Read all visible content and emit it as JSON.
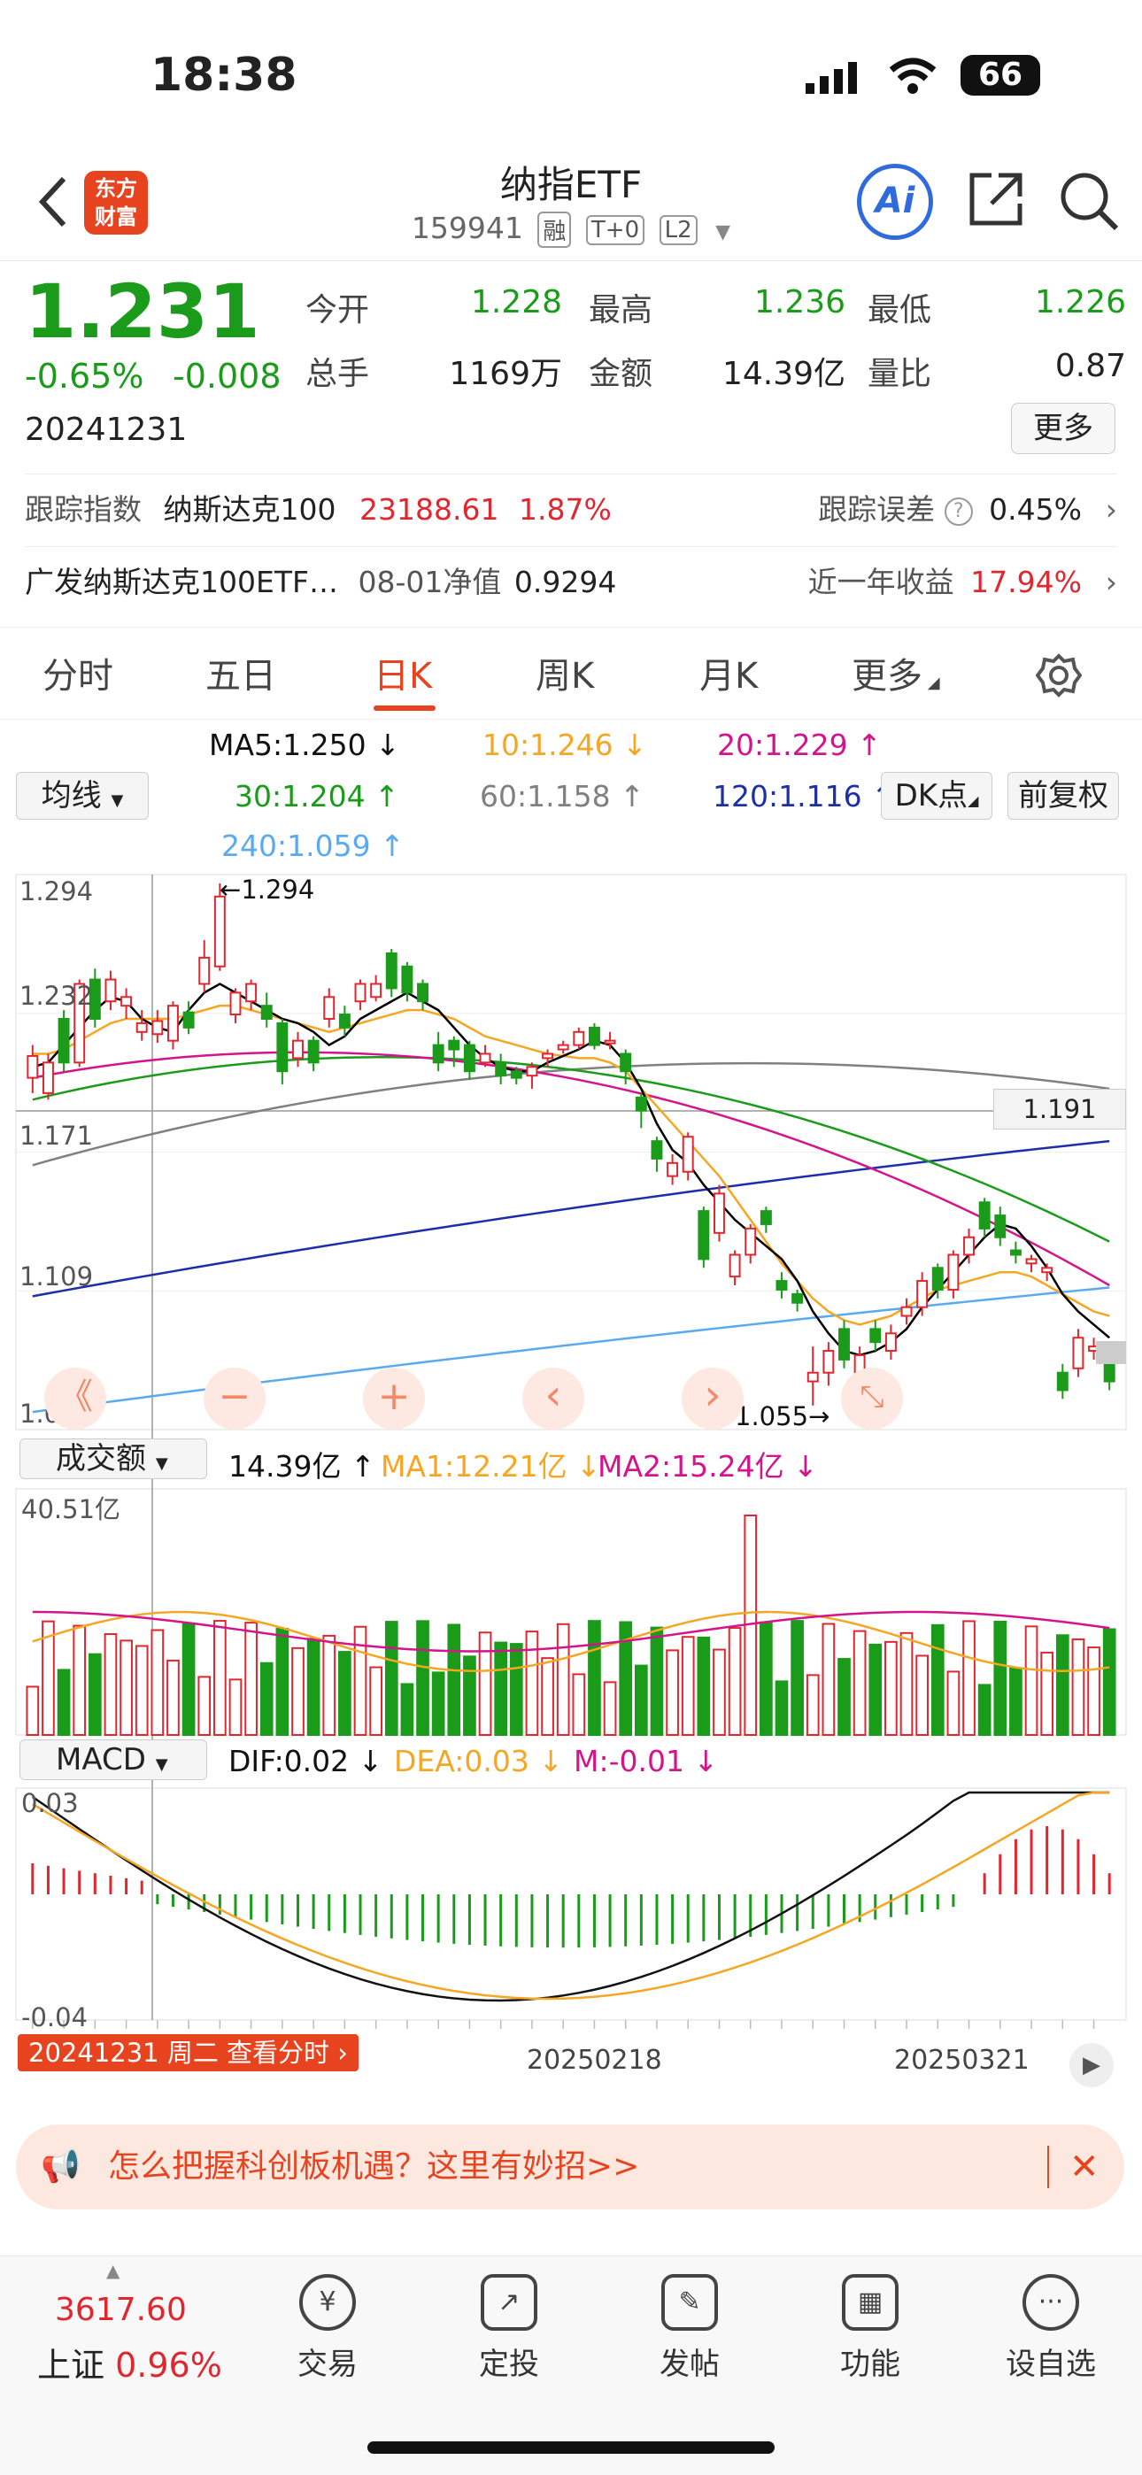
{
  "status_bar": {
    "time": "18:38",
    "battery": "66"
  },
  "header": {
    "logo_line1": "东方",
    "logo_line2": "财富",
    "title": "纳指ETF",
    "code": "159941",
    "tags": [
      "融",
      "T+0",
      "L2"
    ],
    "ai_label": "Ai"
  },
  "quote": {
    "price": "1.231",
    "change_pct": "-0.65%",
    "change": "-0.008",
    "date": "20241231",
    "open_label": "今开",
    "open": "1.228",
    "high_label": "最高",
    "high": "1.236",
    "low_label": "最低",
    "low": "1.226",
    "volume_label": "总手",
    "volume": "1169万",
    "amount_label": "金额",
    "amount": "14.39亿",
    "ratio_label": "量比",
    "ratio": "0.87",
    "more_label": "更多"
  },
  "tracking": {
    "label": "跟踪指数",
    "index_name": "纳斯达克100",
    "index_value": "23188.61",
    "index_pct": "1.87%",
    "error_label": "跟踪误差",
    "error_value": "0.45%"
  },
  "fund": {
    "name": "广发纳斯达克100ETF…",
    "nav_label": "08-01净值",
    "nav": "0.9294",
    "return_label": "近一年收益",
    "return_value": "17.94%"
  },
  "tabs": [
    "分时",
    "五日",
    "日K",
    "周K",
    "月K",
    "更多"
  ],
  "ma_legend": {
    "selector": "均线",
    "ma5": "MA5:1.250",
    "ma10": "10:1.246",
    "ma20": "20:1.229",
    "ma30": "30:1.204",
    "ma60": "60:1.158",
    "ma120": "120:1.116",
    "ma240": "240:1.059",
    "dk_label": "DK点",
    "adjust_label": "前复权"
  },
  "colors": {
    "up": "#e0262e",
    "down": "#1a9b1a",
    "accent": "#e8431f",
    "ma5": "#000000",
    "ma10": "#f5a623",
    "ma20": "#d4148c",
    "ma30": "#1a9b1a",
    "ma60": "#808080",
    "ma120": "#1c2fa8",
    "ma240": "#5aaaf0"
  },
  "kline": {
    "y_labels": [
      "1.294",
      "1.232",
      "1.171",
      "1.109",
      "1.048"
    ],
    "max_marker": "1.294",
    "min_marker": "1.055",
    "crosshair_price": "1.191",
    "controls": [
      "《",
      "−",
      "+",
      "‹",
      "›"
    ]
  },
  "volume_panel": {
    "selector": "成交额",
    "value": "14.39亿",
    "ma1": "MA1:12.21亿",
    "ma2": "MA2:15.24亿",
    "max_label": "40.51亿"
  },
  "macd_panel": {
    "selector": "MACD",
    "dif": "DIF:0.02",
    "dea": "DEA:0.03",
    "m": "M:-0.01",
    "top_label": "0.03",
    "bottom_label": "-0.04",
    "date_left": "20241231 周二 查看分时",
    "date_mid": "20250218",
    "date_right": "20250321"
  },
  "chart_data": {
    "type": "candlestick",
    "title": "",
    "ylim": [
      1.048,
      1.294
    ],
    "candles": [
      {
        "o": 1.205,
        "c": 1.215,
        "h": 1.22,
        "l": 1.198
      },
      {
        "o": 1.198,
        "c": 1.212,
        "h": 1.216,
        "l": 1.195
      },
      {
        "o": 1.232,
        "c": 1.212,
        "h": 1.236,
        "l": 1.208
      },
      {
        "o": 1.212,
        "c": 1.248,
        "h": 1.25,
        "l": 1.21
      },
      {
        "o": 1.25,
        "c": 1.232,
        "h": 1.255,
        "l": 1.228
      },
      {
        "o": 1.24,
        "c": 1.25,
        "h": 1.254,
        "l": 1.236
      },
      {
        "o": 1.238,
        "c": 1.242,
        "h": 1.246,
        "l": 1.232
      },
      {
        "o": 1.226,
        "c": 1.23,
        "h": 1.236,
        "l": 1.222
      },
      {
        "o": 1.225,
        "c": 1.231,
        "h": 1.236,
        "l": 1.221
      },
      {
        "o": 1.222,
        "c": 1.238,
        "h": 1.24,
        "l": 1.218
      },
      {
        "o": 1.235,
        "c": 1.228,
        "h": 1.24,
        "l": 1.225
      },
      {
        "o": 1.248,
        "c": 1.26,
        "h": 1.268,
        "l": 1.244
      },
      {
        "o": 1.256,
        "c": 1.288,
        "h": 1.294,
        "l": 1.254
      },
      {
        "o": 1.234,
        "c": 1.244,
        "h": 1.246,
        "l": 1.23
      },
      {
        "o": 1.24,
        "c": 1.248,
        "h": 1.25,
        "l": 1.236
      },
      {
        "o": 1.238,
        "c": 1.232,
        "h": 1.244,
        "l": 1.228
      },
      {
        "o": 1.23,
        "c": 1.208,
        "h": 1.232,
        "l": 1.202
      },
      {
        "o": 1.214,
        "c": 1.222,
        "h": 1.226,
        "l": 1.21
      },
      {
        "o": 1.222,
        "c": 1.212,
        "h": 1.224,
        "l": 1.208
      },
      {
        "o": 1.232,
        "c": 1.242,
        "h": 1.246,
        "l": 1.228
      },
      {
        "o": 1.234,
        "c": 1.228,
        "h": 1.238,
        "l": 1.224
      },
      {
        "o": 1.24,
        "c": 1.248,
        "h": 1.25,
        "l": 1.236
      },
      {
        "o": 1.242,
        "c": 1.248,
        "h": 1.252,
        "l": 1.24
      },
      {
        "o": 1.262,
        "c": 1.246,
        "h": 1.264,
        "l": 1.242
      },
      {
        "o": 1.256,
        "c": 1.244,
        "h": 1.258,
        "l": 1.24
      },
      {
        "o": 1.248,
        "c": 1.24,
        "h": 1.25,
        "l": 1.236
      },
      {
        "o": 1.22,
        "c": 1.212,
        "h": 1.226,
        "l": 1.208
      },
      {
        "o": 1.222,
        "c": 1.218,
        "h": 1.224,
        "l": 1.21
      },
      {
        "o": 1.22,
        "c": 1.208,
        "h": 1.222,
        "l": 1.204
      },
      {
        "o": 1.212,
        "c": 1.216,
        "h": 1.22,
        "l": 1.21
      },
      {
        "o": 1.212,
        "c": 1.206,
        "h": 1.216,
        "l": 1.202
      },
      {
        "o": 1.208,
        "c": 1.205,
        "h": 1.21,
        "l": 1.202
      },
      {
        "o": 1.206,
        "c": 1.21,
        "h": 1.212,
        "l": 1.2
      },
      {
        "o": 1.214,
        "c": 1.216,
        "h": 1.218,
        "l": 1.21
      },
      {
        "o": 1.218,
        "c": 1.22,
        "h": 1.222,
        "l": 1.216
      },
      {
        "o": 1.22,
        "c": 1.226,
        "h": 1.228,
        "l": 1.218
      },
      {
        "o": 1.228,
        "c": 1.22,
        "h": 1.23,
        "l": 1.218
      },
      {
        "o": 1.222,
        "c": 1.222,
        "h": 1.226,
        "l": 1.218
      },
      {
        "o": 1.216,
        "c": 1.208,
        "h": 1.218,
        "l": 1.202
      },
      {
        "o": 1.196,
        "c": 1.19,
        "h": 1.198,
        "l": 1.182
      },
      {
        "o": 1.176,
        "c": 1.168,
        "h": 1.178,
        "l": 1.162
      },
      {
        "o": 1.16,
        "c": 1.166,
        "h": 1.17,
        "l": 1.156
      },
      {
        "o": 1.162,
        "c": 1.178,
        "h": 1.18,
        "l": 1.158
      },
      {
        "o": 1.144,
        "c": 1.122,
        "h": 1.146,
        "l": 1.118
      },
      {
        "o": 1.134,
        "c": 1.152,
        "h": 1.156,
        "l": 1.13
      },
      {
        "o": 1.114,
        "c": 1.124,
        "h": 1.126,
        "l": 1.11
      },
      {
        "o": 1.124,
        "c": 1.136,
        "h": 1.138,
        "l": 1.12
      },
      {
        "o": 1.144,
        "c": 1.138,
        "h": 1.146,
        "l": 1.134
      },
      {
        "o": 1.112,
        "c": 1.108,
        "h": 1.116,
        "l": 1.104
      },
      {
        "o": 1.106,
        "c": 1.102,
        "h": 1.108,
        "l": 1.098
      },
      {
        "o": 1.066,
        "c": 1.07,
        "h": 1.082,
        "l": 1.055
      },
      {
        "o": 1.07,
        "c": 1.08,
        "h": 1.084,
        "l": 1.064
      },
      {
        "o": 1.09,
        "c": 1.076,
        "h": 1.094,
        "l": 1.072
      },
      {
        "o": 1.068,
        "c": 1.078,
        "h": 1.082,
        "l": 1.06
      },
      {
        "o": 1.09,
        "c": 1.084,
        "h": 1.094,
        "l": 1.08
      },
      {
        "o": 1.08,
        "c": 1.088,
        "h": 1.092,
        "l": 1.076
      },
      {
        "o": 1.096,
        "c": 1.1,
        "h": 1.104,
        "l": 1.092
      },
      {
        "o": 1.1,
        "c": 1.112,
        "h": 1.116,
        "l": 1.096
      },
      {
        "o": 1.118,
        "c": 1.108,
        "h": 1.12,
        "l": 1.104
      },
      {
        "o": 1.108,
        "c": 1.124,
        "h": 1.126,
        "l": 1.104
      },
      {
        "o": 1.124,
        "c": 1.132,
        "h": 1.136,
        "l": 1.12
      },
      {
        "o": 1.148,
        "c": 1.136,
        "h": 1.15,
        "l": 1.132
      },
      {
        "o": 1.142,
        "c": 1.132,
        "h": 1.146,
        "l": 1.128
      },
      {
        "o": 1.126,
        "c": 1.124,
        "h": 1.13,
        "l": 1.12
      },
      {
        "o": 1.12,
        "c": 1.122,
        "h": 1.124,
        "l": 1.116
      },
      {
        "o": 1.116,
        "c": 1.118,
        "h": 1.12,
        "l": 1.112
      },
      {
        "o": 1.07,
        "c": 1.062,
        "h": 1.074,
        "l": 1.058
      },
      {
        "o": 1.072,
        "c": 1.086,
        "h": 1.09,
        "l": 1.068
      },
      {
        "o": 1.08,
        "c": 1.082,
        "h": 1.086,
        "l": 1.076
      },
      {
        "o": 1.074,
        "c": 1.066,
        "h": 1.078,
        "l": 1.062
      }
    ],
    "ma5": [
      1.21,
      1.212,
      1.22,
      1.228,
      1.236,
      1.242,
      1.24,
      1.232,
      1.228,
      1.226,
      1.236,
      1.244,
      1.248,
      1.244,
      1.24,
      1.236,
      1.232,
      1.23,
      1.226,
      1.22,
      1.224,
      1.232,
      1.236,
      1.24,
      1.244,
      1.24,
      1.236,
      1.228,
      1.22,
      1.214,
      1.21,
      1.208,
      1.208,
      1.212,
      1.215,
      1.218,
      1.222,
      1.22,
      1.212,
      1.2,
      1.184,
      1.172,
      1.166,
      1.156,
      1.148,
      1.14,
      1.134,
      1.128,
      1.122,
      1.112,
      1.098,
      1.088,
      1.08,
      1.078,
      1.08,
      1.084,
      1.09,
      1.1,
      1.108,
      1.116,
      1.124,
      1.132,
      1.138,
      1.136,
      1.128,
      1.118,
      1.106,
      1.098,
      1.092,
      1.086
    ],
    "ma10": [
      1.216,
      1.216,
      1.218,
      1.222,
      1.226,
      1.23,
      1.232,
      1.232,
      1.232,
      1.232,
      1.234,
      1.236,
      1.238,
      1.238,
      1.236,
      1.234,
      1.232,
      1.23,
      1.228,
      1.226,
      1.228,
      1.23,
      1.232,
      1.234,
      1.236,
      1.236,
      1.234,
      1.232,
      1.228,
      1.224,
      1.222,
      1.22,
      1.218,
      1.216,
      1.215,
      1.214,
      1.214,
      1.212,
      1.208,
      1.2,
      1.192,
      1.184,
      1.176,
      1.168,
      1.16,
      1.15,
      1.14,
      1.13,
      1.12,
      1.112,
      1.104,
      1.098,
      1.094,
      1.092,
      1.094,
      1.096,
      1.1,
      1.104,
      1.108,
      1.11,
      1.112,
      1.114,
      1.116,
      1.116,
      1.114,
      1.11,
      1.106,
      1.102,
      1.098,
      1.096
    ]
  }
}
